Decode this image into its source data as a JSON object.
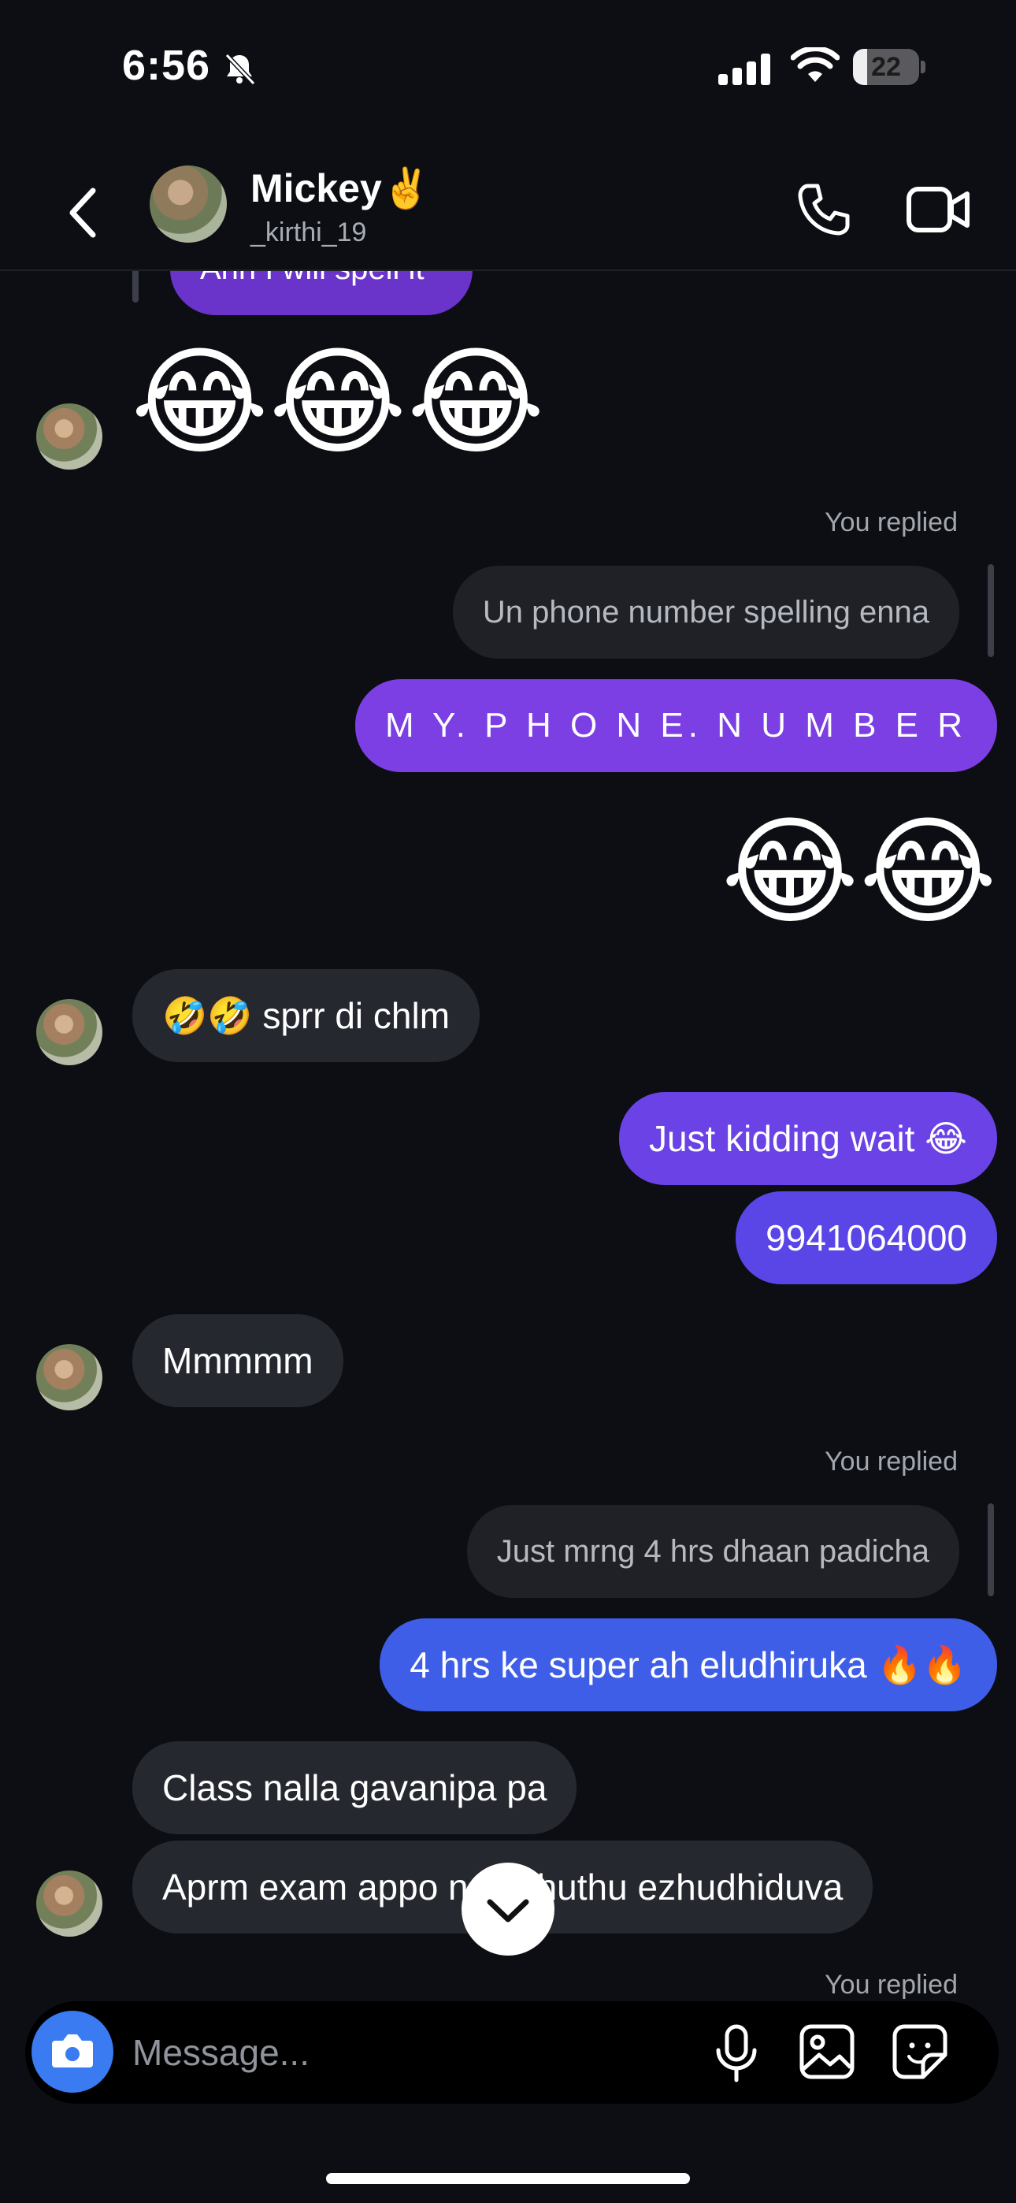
{
  "status_bar": {
    "time": "6:56",
    "battery": "22",
    "battery_level": 0.22
  },
  "header": {
    "contact_name": "Mickey✌️",
    "contact_handle": "_kirthi_19"
  },
  "messages": {
    "partial_top_text": "Ahh I will spell it",
    "laugh_emojis_in": "😂😂😂",
    "reply1_label": "You replied",
    "reply1_quote": "Un phone number spelling enna",
    "msg_phone_spelled": "M Y. P H O N E. N U M B E R",
    "laugh_emojis_out": "😂😂",
    "msg_sprr": "🤣🤣 sprr di chlm",
    "msg_kidding": "Just kidding wait 😂",
    "msg_number": "9941064000",
    "msg_mmmmm": "Mmmmm",
    "reply2_label": "You replied",
    "reply2_quote": "Just mrng 4 hrs dhaan padicha",
    "msg_4hrs": "4 hrs ke super ah eludhiruka 🔥🔥",
    "msg_class": "Class nalla gavanipa pa",
    "msg_aprm": "Aprm exam appo ne ezhuthu ezhudhiduva",
    "reply3_label": "You replied"
  },
  "composer": {
    "placeholder": "Message..."
  },
  "colors": {
    "background": "#0c0e13",
    "incoming_bubble": "#262830",
    "outgoing_purple": "#7b3fe4",
    "outgoing_violet": "#5a45e6",
    "outgoing_blue": "#3e5ee8",
    "camera_button": "#3a7bf2"
  },
  "icons": [
    "bell-slash-icon",
    "signal-icon",
    "wifi-icon",
    "battery-icon",
    "chevron-left-icon",
    "phone-icon",
    "video-icon",
    "chevron-down-icon",
    "camera-icon",
    "mic-icon",
    "image-icon",
    "sticker-icon"
  ]
}
